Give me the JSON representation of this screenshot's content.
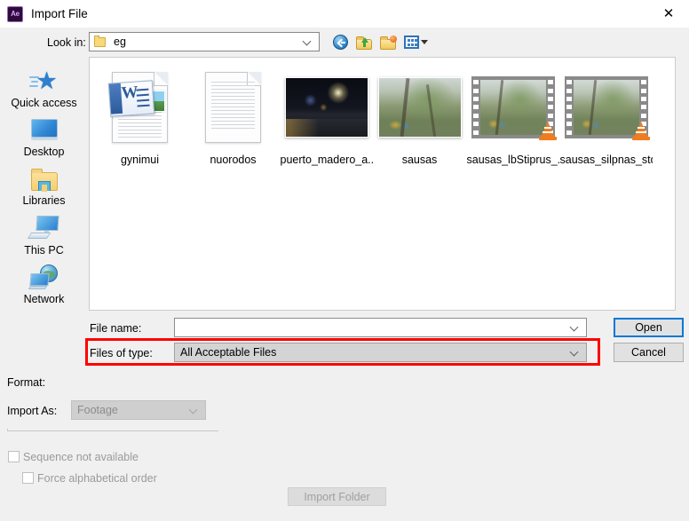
{
  "window": {
    "app_icon": "ae-icon",
    "title": "Import File",
    "close_label": "✕"
  },
  "toolbar": {
    "lookin_label": "Look in:",
    "lookin_value": "eg",
    "buttons": [
      {
        "name": "back-button",
        "icon": "back-arrow-icon"
      },
      {
        "name": "up-one-level-button",
        "icon": "folder-up-icon"
      },
      {
        "name": "new-folder-button",
        "icon": "new-folder-icon"
      },
      {
        "name": "view-menu-button",
        "icon": "views-icon"
      }
    ]
  },
  "sidebar": {
    "items": [
      {
        "label": "Quick access",
        "icon": "quick-access-star-icon"
      },
      {
        "label": "Desktop",
        "icon": "desktop-monitor-icon"
      },
      {
        "label": "Libraries",
        "icon": "libraries-folder-icon"
      },
      {
        "label": "This PC",
        "icon": "this-pc-icon"
      },
      {
        "label": "Network",
        "icon": "network-globe-icon"
      }
    ]
  },
  "files": [
    {
      "name": "gynimui",
      "kind": "word-document"
    },
    {
      "name": "nuorodos",
      "kind": "text-document"
    },
    {
      "name": "puerto_madero_a...",
      "kind": "photo-night"
    },
    {
      "name": "sausas",
      "kind": "photo-tree"
    },
    {
      "name": "sausas_lbStiprus_...",
      "kind": "video-film"
    },
    {
      "name": "sausas_silpnas_std",
      "kind": "video-film"
    }
  ],
  "form": {
    "file_name_label": "File name:",
    "file_name_value": "",
    "file_name_placeholder": "",
    "files_of_type_label": "Files of type:",
    "files_of_type_value": "All Acceptable Files",
    "open_label": "Open",
    "cancel_label": "Cancel"
  },
  "options": {
    "format_label": "Format:",
    "format_value": "",
    "import_as_label": "Import As:",
    "import_as_value": "Footage",
    "sequence_label": "Sequence not available",
    "sequence_checked": false,
    "force_alpha_label": "Force alphabetical order",
    "force_alpha_checked": false,
    "import_folder_label": "Import Folder"
  },
  "highlight": {
    "color": "#ff0000",
    "target": "files-of-type-row"
  }
}
